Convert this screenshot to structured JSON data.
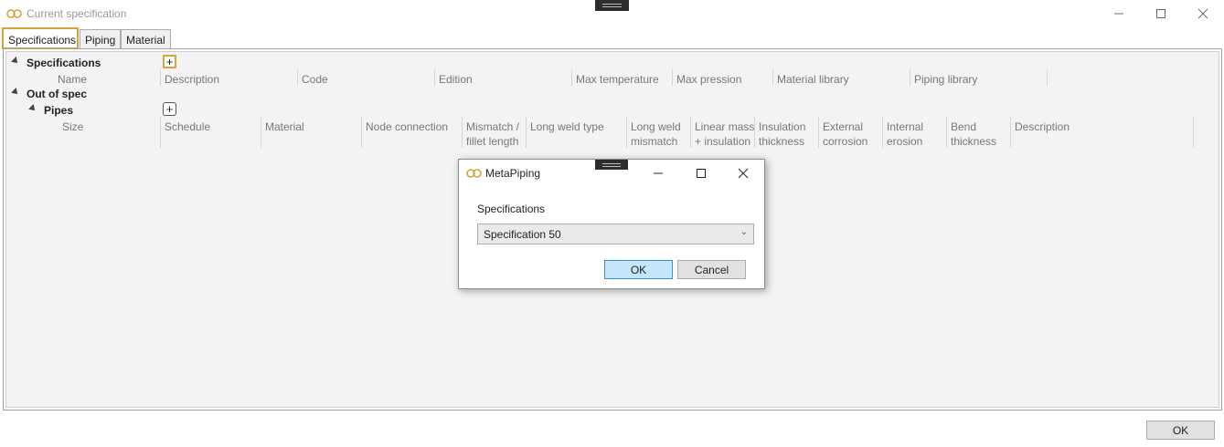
{
  "window": {
    "title": "Current specification"
  },
  "tabs": [
    {
      "label": "Specifications",
      "active": true
    },
    {
      "label": "Piping",
      "active": false
    },
    {
      "label": "Material",
      "active": false
    }
  ],
  "tree": {
    "specifications_label": "Specifications",
    "out_of_spec_label": "Out of spec",
    "pipes_label": "Pipes"
  },
  "spec_columns": [
    "Name",
    "Description",
    "Code",
    "Edition",
    "Max temperature",
    "Max pression",
    "Material library",
    "Piping library"
  ],
  "pipe_columns": [
    [
      "Size"
    ],
    [
      "Schedule"
    ],
    [
      "Material"
    ],
    [
      "Node connection"
    ],
    [
      "Mismatch /",
      "fillet length"
    ],
    [
      "Long weld type"
    ],
    [
      "Long weld",
      "mismatch"
    ],
    [
      "Linear mass",
      "+ insulation"
    ],
    [
      "Insulation",
      "thickness"
    ],
    [
      "External",
      "corrosion"
    ],
    [
      "Internal",
      "erosion"
    ],
    [
      "Bend",
      "thickness"
    ],
    [
      "Description"
    ]
  ],
  "dialog": {
    "title": "MetaPiping",
    "label": "Specifications",
    "selected": "Specification 50",
    "ok": "OK",
    "cancel": "Cancel"
  },
  "footer": {
    "ok": "OK"
  },
  "colors": {
    "accent": "#d6a23a",
    "primary_button": "#c5e5fb"
  }
}
